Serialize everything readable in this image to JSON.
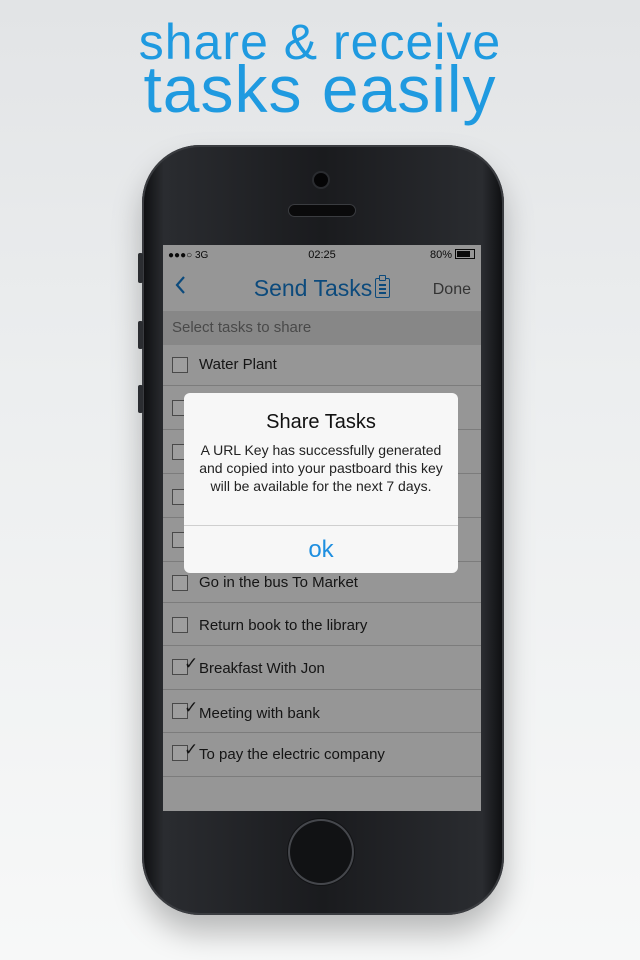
{
  "headline": {
    "line1": "share & receive",
    "line2": "tasks easily"
  },
  "status_bar": {
    "carrier": "●●●○ 3G",
    "time": "02:25",
    "battery": "80%"
  },
  "nav": {
    "back_icon": "chevron-left-icon",
    "title": "Send Tasks",
    "title_icon": "clipboard-icon",
    "done_label": "Done"
  },
  "section_header": "Select tasks to share",
  "tasks": [
    {
      "label": "Water Plant",
      "checked": false
    },
    {
      "label": "",
      "checked": false
    },
    {
      "label": "",
      "checked": false
    },
    {
      "label": "",
      "checked": false
    },
    {
      "label": "",
      "checked": false
    },
    {
      "label": "Go in the bus To Market",
      "checked": false
    },
    {
      "label": "Return book to the library",
      "checked": false
    },
    {
      "label": "Breakfast With Jon",
      "checked": true
    },
    {
      "label": "Meeting with bank",
      "checked": true
    },
    {
      "label": "To pay the electric company",
      "checked": true
    }
  ],
  "alert": {
    "title": "Share Tasks",
    "message": "A URL Key has successfully generated and copied into your pastboard this key will be available for the next 7 days.",
    "ok_label": "ok"
  },
  "colors": {
    "accent": "#1f9ae0",
    "nav_blue": "#1478c8"
  }
}
